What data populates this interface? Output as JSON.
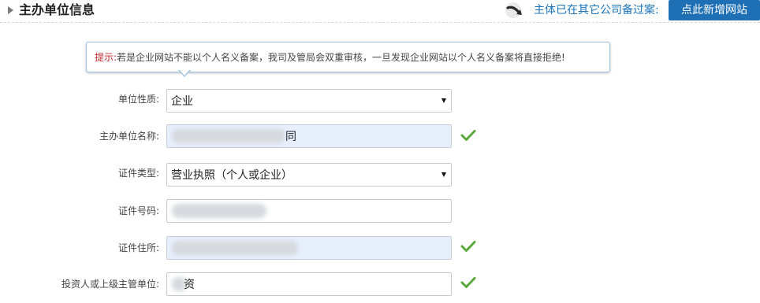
{
  "header": {
    "section_title": "主办单位信息",
    "link_text": "主体已在其它公司备过案:",
    "add_button": "点此新增网站"
  },
  "tip": {
    "prefix": "提示:",
    "text": "若是企业网站不能以个人名义备案，我司及管局会双重审核，一旦发现企业网站以个人名义备案将直接拒绝!"
  },
  "form": {
    "fields": [
      {
        "label": "单位性质:",
        "value": "企业",
        "type": "select"
      },
      {
        "label": "主办单位名称:",
        "value": "同",
        "type": "text",
        "status": "valid"
      },
      {
        "label": "证件类型:",
        "value": "营业执照（个人或企业）",
        "type": "select"
      },
      {
        "label": "证件号码:",
        "value": "",
        "type": "text"
      },
      {
        "label": "证件住所:",
        "value": "",
        "type": "text",
        "status": "valid"
      },
      {
        "label": "投资人或上级主管单位:",
        "value": "资",
        "type": "text",
        "status": "valid"
      }
    ]
  },
  "colors": {
    "accent": "#1e6fb3",
    "link": "#1b73b8",
    "tip_prefix": "#c1272d",
    "valid": "#5aa83a",
    "filled_bg": "#e7effd"
  },
  "icons": [
    "section-arrow-icon",
    "link-arrow-icon",
    "select-caret-icon",
    "check-icon"
  ]
}
